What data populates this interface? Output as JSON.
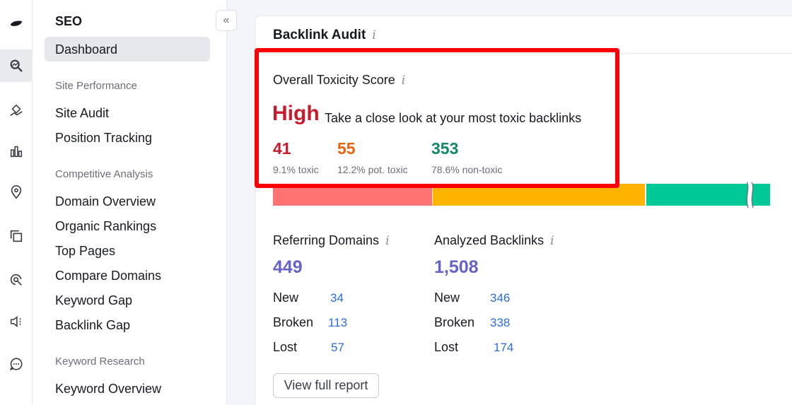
{
  "rail": {
    "icons": [
      "semrush-logo-icon",
      "seo-icon",
      "local-icon",
      "advertising-icon",
      "location-pin-icon",
      "content-icon",
      "ai-icon",
      "social-icon",
      "chat-icon",
      "reports-icon"
    ]
  },
  "sidebar": {
    "title": "SEO",
    "active_item": "Dashboard",
    "sections": [
      {
        "label": "Site Performance",
        "items": [
          "Site Audit",
          "Position Tracking"
        ]
      },
      {
        "label": "Competitive Analysis",
        "items": [
          "Domain Overview",
          "Organic Rankings",
          "Top Pages",
          "Compare Domains",
          "Keyword Gap",
          "Backlink Gap"
        ]
      },
      {
        "label": "Keyword Research",
        "items": [
          "Keyword Overview"
        ]
      }
    ],
    "collapse_glyph": "«"
  },
  "card": {
    "title": "Backlink Audit",
    "info_glyph": "i"
  },
  "toxicity": {
    "label": "Overall Toxicity Score",
    "level": "High",
    "description": "Take a close look at your most toxic backlinks",
    "metrics": [
      {
        "value": "41",
        "caption": "9.1% toxic",
        "color": "#c91b2b"
      },
      {
        "value": "55",
        "caption": "12.2% pot. toxic",
        "color": "#e8650f"
      },
      {
        "value": "353",
        "caption": "78.6% non-toxic",
        "color": "#0f8a5f"
      }
    ],
    "bar_shares": [
      0.091,
      0.122,
      0.786
    ],
    "bar_colors": [
      "#ff7373",
      "#ffb400",
      "#00c896"
    ]
  },
  "referring_domains": {
    "label": "Referring Domains",
    "value": "449",
    "rows": [
      {
        "label": "New",
        "value": "34"
      },
      {
        "label": "Broken",
        "value": "113"
      },
      {
        "label": "Lost",
        "value": "57"
      }
    ]
  },
  "analyzed_backlinks": {
    "label": "Analyzed Backlinks",
    "value": "1,508",
    "rows": [
      {
        "label": "New",
        "value": "346"
      },
      {
        "label": "Broken",
        "value": "338"
      },
      {
        "label": "Lost",
        "value": "174"
      }
    ]
  },
  "view_full_report": "View full report",
  "colors": {
    "highlight": "#fb0006",
    "accent_purple": "#6463c8",
    "link_blue": "#2b6ed5"
  }
}
